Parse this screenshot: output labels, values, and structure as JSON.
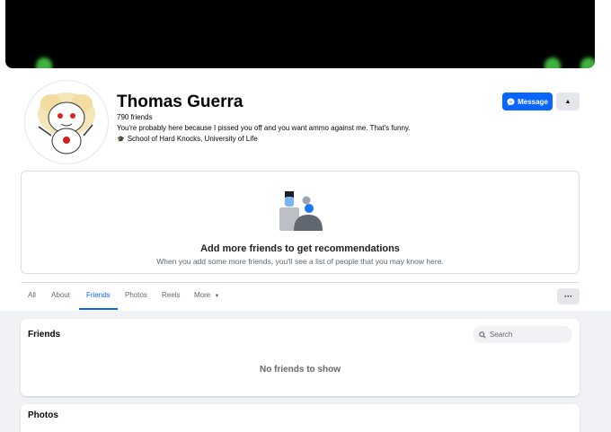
{
  "profile": {
    "name": "Thomas Guerra",
    "friends_count": "790 friends",
    "bio": "You're probably here because I pissed you off and you want ammo against me. That's funny.",
    "education": "School of Hard Knocks, University of Life"
  },
  "actions": {
    "message_label": "Message"
  },
  "recommendations": {
    "title": "Add more friends to get recommendations",
    "subtitle": "When you add some more friends, you'll see a list of people that you may know here."
  },
  "tabs": [
    {
      "label": "All"
    },
    {
      "label": "About"
    },
    {
      "label": "Friends",
      "active": true
    },
    {
      "label": "Photos"
    },
    {
      "label": "Reels"
    },
    {
      "label": "More"
    }
  ],
  "friends_section": {
    "title": "Friends",
    "search_placeholder": "Search",
    "empty_text": "No friends to show"
  },
  "photos_section": {
    "title": "Photos"
  },
  "colors": {
    "accent": "#0866ff",
    "secondary_button": "#e4e6eb",
    "page_background": "#f0f2f5"
  }
}
